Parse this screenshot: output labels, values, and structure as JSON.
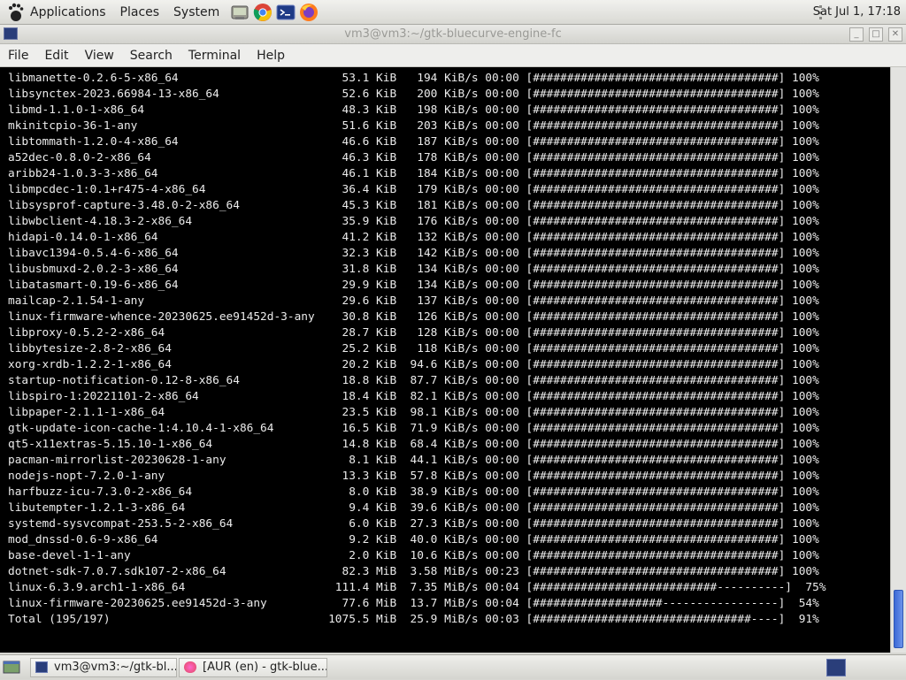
{
  "top_panel": {
    "menus": [
      "Applications",
      "Places",
      "System"
    ],
    "launchers": [
      "system-monitor-icon",
      "chrome-icon",
      "terminal-icon",
      "firefox-icon"
    ],
    "clock": "Sat Jul  1, 17:18"
  },
  "window": {
    "title": "vm3@vm3:~/gtk-bluecurve-engine-fc",
    "menu": [
      "File",
      "Edit",
      "View",
      "Search",
      "Terminal",
      "Help"
    ]
  },
  "terminal": {
    "rows": [
      [
        "libmanette-0.2.6-5-x86_64",
        "53.1 KiB",
        "194 KiB/s",
        "00:00",
        "####################################",
        "100%"
      ],
      [
        "libsynctex-2023.66984-13-x86_64",
        "52.6 KiB",
        "200 KiB/s",
        "00:00",
        "####################################",
        "100%"
      ],
      [
        "libmd-1.1.0-1-x86_64",
        "48.3 KiB",
        "198 KiB/s",
        "00:00",
        "####################################",
        "100%"
      ],
      [
        "mkinitcpio-36-1-any",
        "51.6 KiB",
        "203 KiB/s",
        "00:00",
        "####################################",
        "100%"
      ],
      [
        "libtommath-1.2.0-4-x86_64",
        "46.6 KiB",
        "187 KiB/s",
        "00:00",
        "####################################",
        "100%"
      ],
      [
        "a52dec-0.8.0-2-x86_64",
        "46.3 KiB",
        "178 KiB/s",
        "00:00",
        "####################################",
        "100%"
      ],
      [
        "aribb24-1.0.3-3-x86_64",
        "46.1 KiB",
        "184 KiB/s",
        "00:00",
        "####################################",
        "100%"
      ],
      [
        "libmpcdec-1:0.1+r475-4-x86_64",
        "36.4 KiB",
        "179 KiB/s",
        "00:00",
        "####################################",
        "100%"
      ],
      [
        "libsysprof-capture-3.48.0-2-x86_64",
        "45.3 KiB",
        "181 KiB/s",
        "00:00",
        "####################################",
        "100%"
      ],
      [
        "libwbclient-4.18.3-2-x86_64",
        "35.9 KiB",
        "176 KiB/s",
        "00:00",
        "####################################",
        "100%"
      ],
      [
        "hidapi-0.14.0-1-x86_64",
        "41.2 KiB",
        "132 KiB/s",
        "00:00",
        "####################################",
        "100%"
      ],
      [
        "libavc1394-0.5.4-6-x86_64",
        "32.3 KiB",
        "142 KiB/s",
        "00:00",
        "####################################",
        "100%"
      ],
      [
        "libusbmuxd-2.0.2-3-x86_64",
        "31.8 KiB",
        "134 KiB/s",
        "00:00",
        "####################################",
        "100%"
      ],
      [
        "libatasmart-0.19-6-x86_64",
        "29.9 KiB",
        "134 KiB/s",
        "00:00",
        "####################################",
        "100%"
      ],
      [
        "mailcap-2.1.54-1-any",
        "29.6 KiB",
        "137 KiB/s",
        "00:00",
        "####################################",
        "100%"
      ],
      [
        "linux-firmware-whence-20230625.ee91452d-3-any",
        "30.8 KiB",
        "126 KiB/s",
        "00:00",
        "####################################",
        "100%"
      ],
      [
        "libproxy-0.5.2-2-x86_64",
        "28.7 KiB",
        "128 KiB/s",
        "00:00",
        "####################################",
        "100%"
      ],
      [
        "libbytesize-2.8-2-x86_64",
        "25.2 KiB",
        "118 KiB/s",
        "00:00",
        "####################################",
        "100%"
      ],
      [
        "xorg-xrdb-1.2.2-1-x86_64",
        "20.2 KiB",
        "94.6 KiB/s",
        "00:00",
        "####################################",
        "100%"
      ],
      [
        "startup-notification-0.12-8-x86_64",
        "18.8 KiB",
        "87.7 KiB/s",
        "00:00",
        "####################################",
        "100%"
      ],
      [
        "libspiro-1:20221101-2-x86_64",
        "18.4 KiB",
        "82.1 KiB/s",
        "00:00",
        "####################################",
        "100%"
      ],
      [
        "libpaper-2.1.1-1-x86_64",
        "23.5 KiB",
        "98.1 KiB/s",
        "00:00",
        "####################################",
        "100%"
      ],
      [
        "gtk-update-icon-cache-1:4.10.4-1-x86_64",
        "16.5 KiB",
        "71.9 KiB/s",
        "00:00",
        "####################################",
        "100%"
      ],
      [
        "qt5-x11extras-5.15.10-1-x86_64",
        "14.8 KiB",
        "68.4 KiB/s",
        "00:00",
        "####################################",
        "100%"
      ],
      [
        "pacman-mirrorlist-20230628-1-any",
        "8.1 KiB",
        "44.1 KiB/s",
        "00:00",
        "####################################",
        "100%"
      ],
      [
        "nodejs-nopt-7.2.0-1-any",
        "13.3 KiB",
        "57.8 KiB/s",
        "00:00",
        "####################################",
        "100%"
      ],
      [
        "harfbuzz-icu-7.3.0-2-x86_64",
        "8.0 KiB",
        "38.9 KiB/s",
        "00:00",
        "####################################",
        "100%"
      ],
      [
        "libutempter-1.2.1-3-x86_64",
        "9.4 KiB",
        "39.6 KiB/s",
        "00:00",
        "####################################",
        "100%"
      ],
      [
        "systemd-sysvcompat-253.5-2-x86_64",
        "6.0 KiB",
        "27.3 KiB/s",
        "00:00",
        "####################################",
        "100%"
      ],
      [
        "mod_dnssd-0.6-9-x86_64",
        "9.2 KiB",
        "40.0 KiB/s",
        "00:00",
        "####################################",
        "100%"
      ],
      [
        "base-devel-1-1-any",
        "2.0 KiB",
        "10.6 KiB/s",
        "00:00",
        "####################################",
        "100%"
      ],
      [
        "dotnet-sdk-7.0.7.sdk107-2-x86_64",
        "82.3 MiB",
        "3.58 MiB/s",
        "00:23",
        "####################################",
        "100%"
      ],
      [
        "linux-6.3.9.arch1-1-x86_64",
        "111.4 MiB",
        "7.35 MiB/s",
        "00:04",
        "###########################----------",
        "75%"
      ],
      [
        "linux-firmware-20230625.ee91452d-3-any",
        "77.6 MiB",
        "13.7 MiB/s",
        "00:04",
        "###################-----------------",
        "54%"
      ],
      [
        "Total (195/197)",
        "1075.5 MiB",
        "25.9 MiB/s",
        "00:03",
        "################################----",
        "91%"
      ]
    ]
  },
  "taskbar": {
    "tasks": [
      {
        "label": "vm3@vm3:~/gtk-bl..."
      },
      {
        "label": "[AUR (en) - gtk-blue..."
      }
    ]
  }
}
